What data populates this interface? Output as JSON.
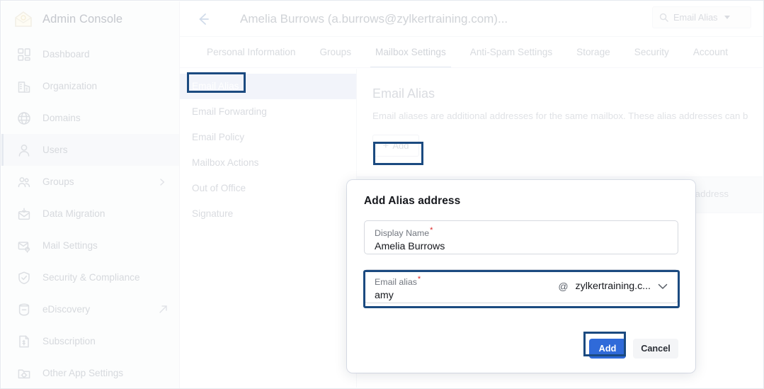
{
  "sidebar": {
    "brand": {
      "title": "Admin Console",
      "logo_icon": "house-envelope-logo-icon"
    },
    "items": [
      {
        "label": "Dashboard",
        "icon": "dashboard-grid-icon",
        "active": false
      },
      {
        "label": "Organization",
        "icon": "building-icon",
        "active": false
      },
      {
        "label": "Domains",
        "icon": "globe-icon",
        "active": false
      },
      {
        "label": "Users",
        "icon": "user-icon",
        "active": true
      },
      {
        "label": "Groups",
        "icon": "group-people-icon",
        "active": false,
        "chevron": "chevron-right-icon"
      },
      {
        "label": "Data Migration",
        "icon": "envelope-download-icon",
        "active": false
      },
      {
        "label": "Mail Settings",
        "icon": "envelope-gear-icon",
        "active": false
      },
      {
        "label": "Security & Compliance",
        "icon": "shield-check-icon",
        "active": false
      },
      {
        "label": "eDiscovery",
        "icon": "search-bucket-icon",
        "active": false,
        "external": "external-link-icon"
      },
      {
        "label": "Subscription",
        "icon": "invoice-icon",
        "active": false
      },
      {
        "label": "Other App Settings",
        "icon": "folder-gear-icon",
        "active": false
      }
    ]
  },
  "topbar": {
    "back_icon": "back-arrow-icon",
    "heading": "Amelia Burrows (a.burrows@zylkertraining.com)...",
    "search": {
      "icon": "search-icon",
      "text": "Email Alias",
      "caret": "caret-down-icon"
    }
  },
  "tabs": [
    {
      "label": "Personal Information",
      "active": false
    },
    {
      "label": "Groups",
      "active": false
    },
    {
      "label": "Mailbox Settings",
      "active": true
    },
    {
      "label": "Anti-Spam Settings",
      "active": false
    },
    {
      "label": "Storage",
      "active": false
    },
    {
      "label": "Security",
      "active": false
    },
    {
      "label": "Account",
      "active": false
    }
  ],
  "subnav": [
    {
      "label": "Email Alias",
      "selected": true
    },
    {
      "label": "Email Forwarding",
      "selected": false
    },
    {
      "label": "Email Policy",
      "selected": false
    },
    {
      "label": "Mailbox Actions",
      "selected": false
    },
    {
      "label": "Out of Office",
      "selected": false
    },
    {
      "label": "Signature",
      "selected": false
    }
  ],
  "panel": {
    "title": "Email Alias",
    "description": "Email aliases are additional addresses for the same mailbox. These alias addresses can b",
    "add_button": {
      "plus": "+",
      "label": "Add"
    },
    "card_label": "lbox address"
  },
  "modal": {
    "title": "Add Alias address",
    "display_name": {
      "label": "Display Name",
      "required_marker": "*",
      "value": "Amelia Burrows"
    },
    "email_alias": {
      "label": "Email alias",
      "required_marker": "*",
      "value": "amy",
      "at_sign": "@",
      "domain": "zylkertraining.c...",
      "chevron_icon": "chevron-down-icon"
    },
    "buttons": {
      "primary": "Add",
      "secondary": "Cancel"
    }
  },
  "colors": {
    "primary_button": "#2f6ad9",
    "annotation_border": "#1b4a80",
    "subnav_selected_bg": "#dfe5f5",
    "required_star": "#dc2626"
  }
}
